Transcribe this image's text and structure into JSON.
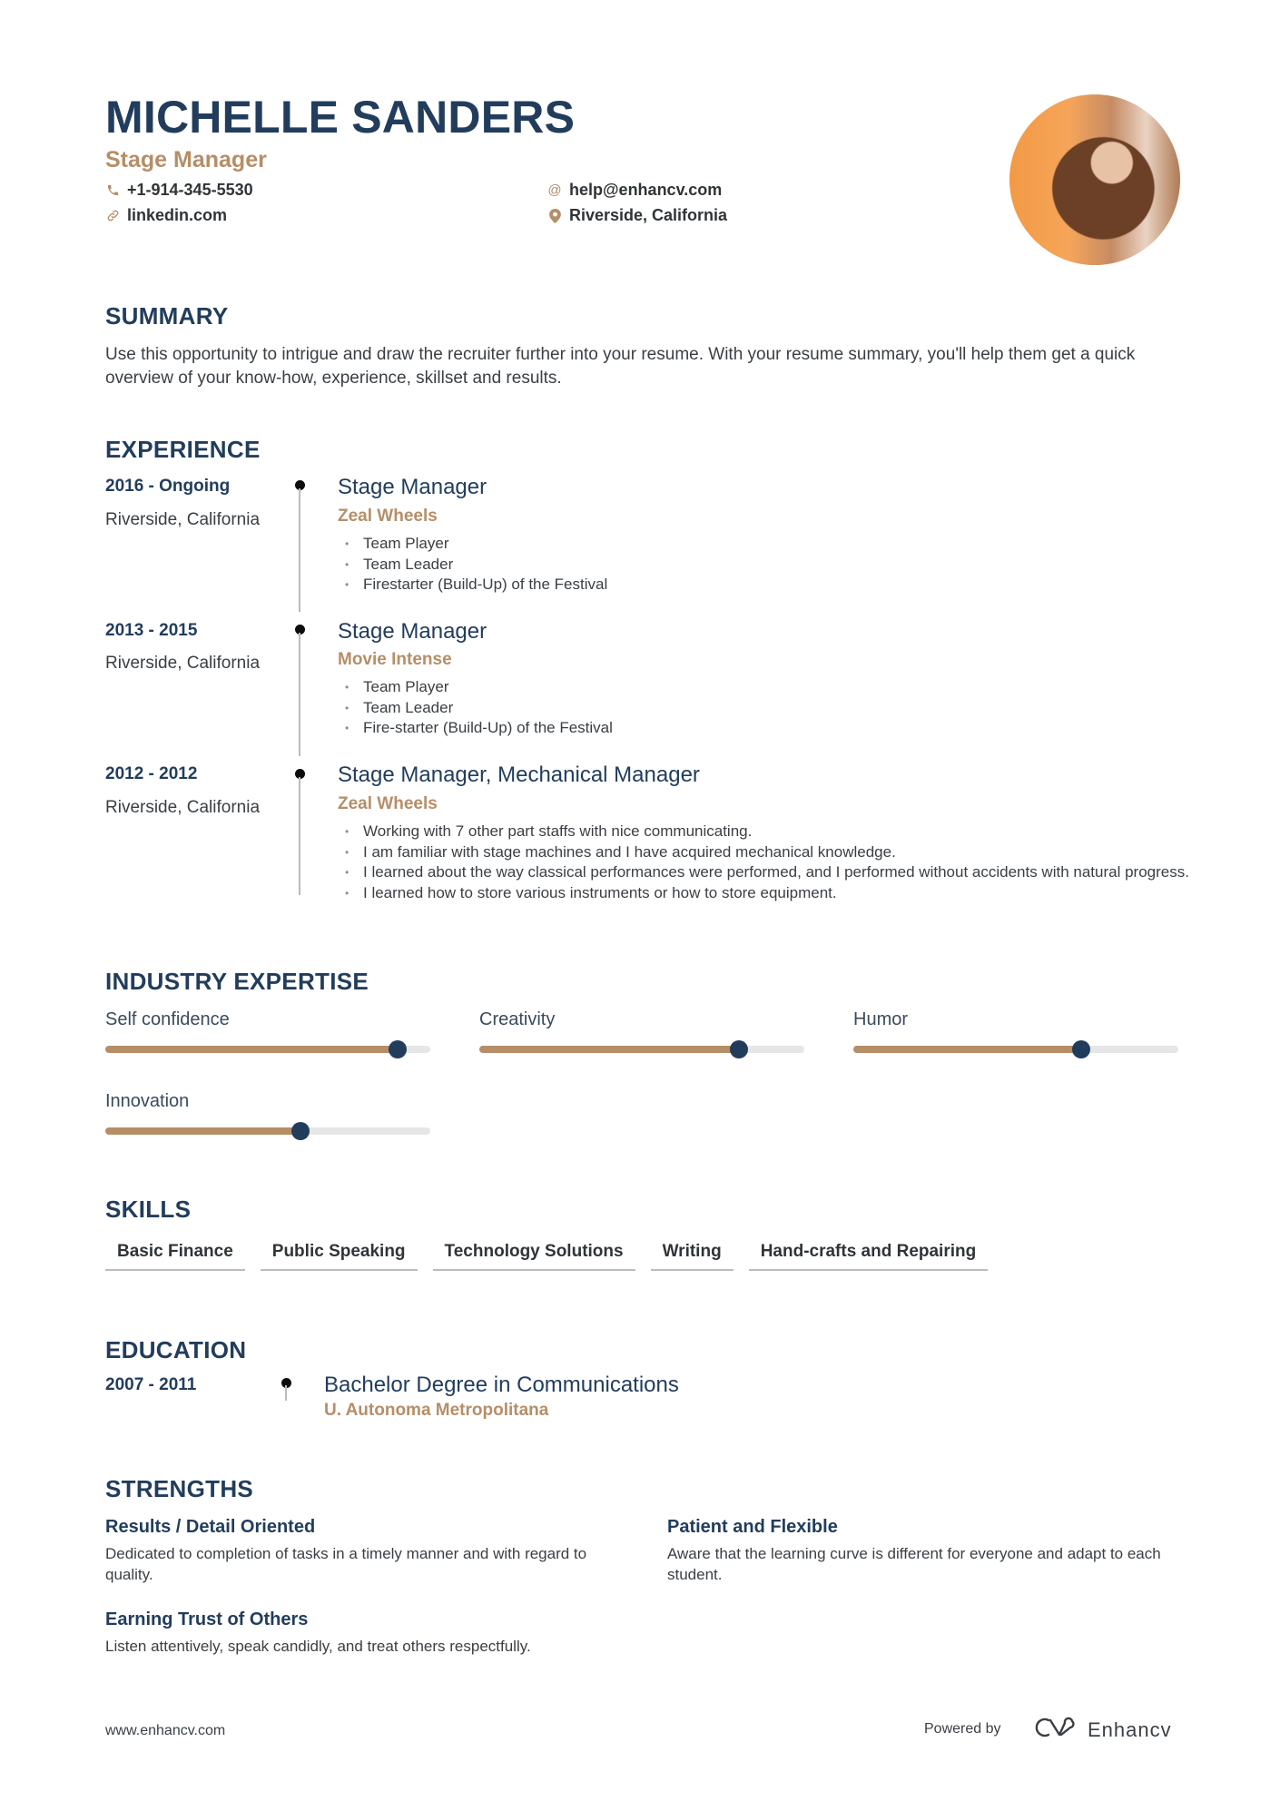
{
  "header": {
    "name": "MICHELLE SANDERS",
    "role": "Stage Manager",
    "contacts": {
      "phone": {
        "icon": "phone-icon",
        "value": "+1-914-345-5530"
      },
      "email": {
        "icon": "at-icon",
        "value": "help@enhancv.com"
      },
      "linkedin": {
        "icon": "link-icon",
        "value": "linkedin.com"
      },
      "location": {
        "icon": "map-pin-icon",
        "value": "Riverside, California"
      }
    },
    "photo_alt": "Profile photo"
  },
  "summary": {
    "title": "SUMMARY",
    "text": "Use this opportunity to intrigue and draw the recruiter further into your resume. With your resume summary, you'll help them get a quick overview of your know-how, experience, skillset and results."
  },
  "experience": {
    "title": "EXPERIENCE",
    "items": [
      {
        "dates": "2016 - Ongoing",
        "location": "Riverside, California",
        "title": "Stage Manager",
        "company": "Zeal Wheels",
        "bullets": [
          "Team Player",
          "Team Leader",
          "Firestarter (Build-Up) of the Festival"
        ]
      },
      {
        "dates": "2013 - 2015",
        "location": "Riverside, California",
        "title": "Stage Manager",
        "company": "Movie Intense",
        "bullets": [
          "Team Player",
          "Team Leader",
          "Fire-starter (Build-Up) of the Festival"
        ]
      },
      {
        "dates": "2012 - 2012",
        "location": "Riverside, California",
        "title": "Stage Manager, Mechanical Manager",
        "company": "Zeal Wheels",
        "bullets": [
          "Working with 7 other part staffs with nice communicating.",
          "I am familiar with stage machines and I have acquired mechanical knowledge.",
          "I learned about the way classical performances were performed, and I performed without accidents with natural progress.",
          "I learned how to store various instruments or how to store equipment."
        ]
      }
    ]
  },
  "industry_expertise": {
    "title": "INDUSTRY EXPERTISE",
    "items": [
      {
        "label": "Self confidence",
        "level": 0.9
      },
      {
        "label": "Creativity",
        "level": 0.8
      },
      {
        "label": "Humor",
        "level": 0.7
      },
      {
        "label": "Innovation",
        "level": 0.6
      }
    ]
  },
  "skills": {
    "title": "SKILLS",
    "items": [
      "Basic Finance",
      "Public Speaking",
      "Technology Solutions",
      "Writing",
      "Hand-crafts and Repairing"
    ]
  },
  "education": {
    "title": "EDUCATION",
    "items": [
      {
        "dates": "2007 - 2011",
        "degree": "Bachelor Degree in Communications",
        "school": "U. Autonoma Metropolitana"
      }
    ]
  },
  "strengths": {
    "title": "STRENGTHS",
    "items": [
      {
        "title": "Results / Detail Oriented",
        "description": "Dedicated to completion of tasks in a timely manner and with regard to quality."
      },
      {
        "title": "Patient and Flexible",
        "description": "Aware that the learning curve is different for everyone and adapt to each student."
      },
      {
        "title": "Earning Trust of Others",
        "description": "Listen attentively, speak candidly, and treat others respectfully."
      }
    ]
  },
  "footer": {
    "website": "www.enhancv.com",
    "powered_by": "Powered by",
    "brand": "Enhancv",
    "brand_icon": "enhancv-logo-icon"
  },
  "colors": {
    "primary": "#223d5c",
    "accent": "#b58e68",
    "text": "#3a3f44",
    "track": "#e6e6e6"
  }
}
